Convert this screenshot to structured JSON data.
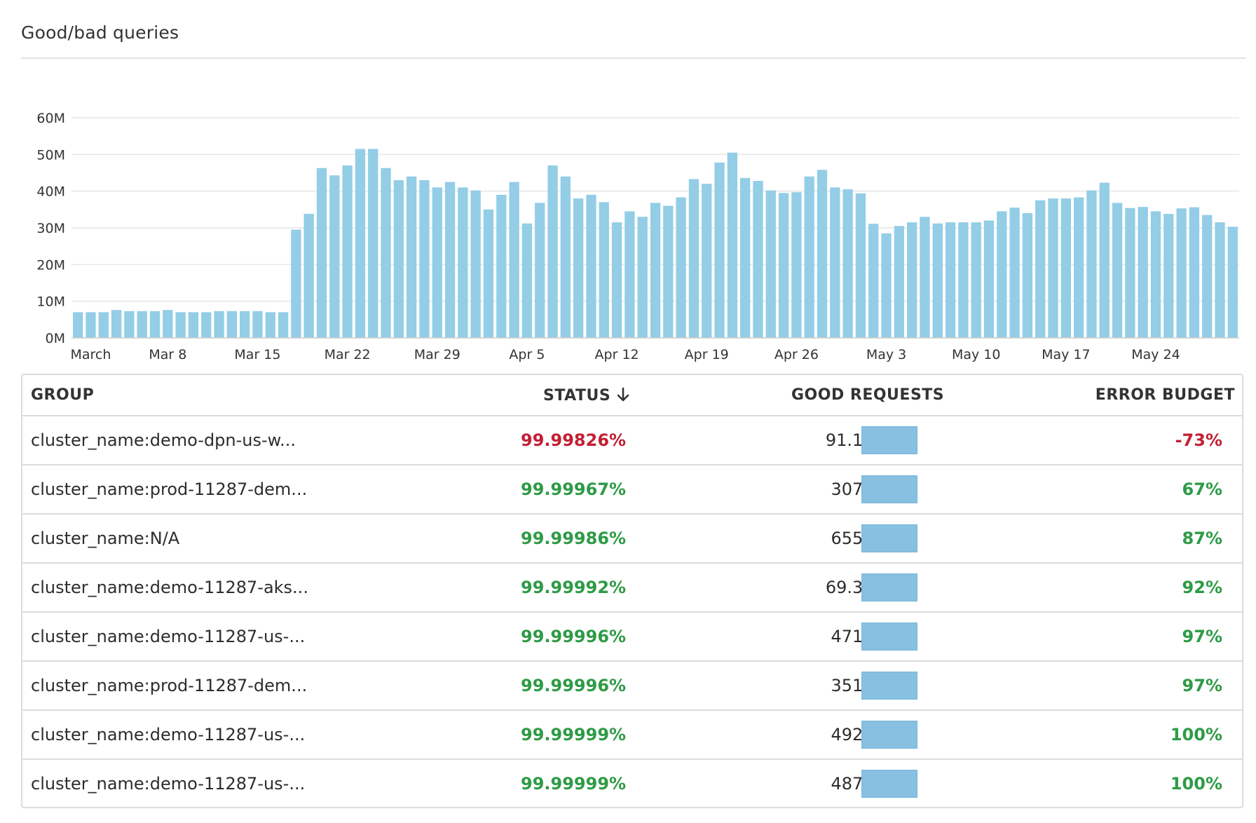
{
  "widget": {
    "title": "Good/bad queries"
  },
  "colors": {
    "bar": "#93cde6",
    "grid": "#e6e6e6",
    "good": "#2e9b46",
    "bad": "#c41f34",
    "row_bar": "#87c0e1"
  },
  "chart_data": {
    "type": "bar",
    "title": "",
    "ylim": [
      0,
      60000000
    ],
    "y_ticks": [
      "0M",
      "10M",
      "20M",
      "30M",
      "40M",
      "50M",
      "60M"
    ],
    "x_tick_labels": [
      "March",
      "Mar 8",
      "Mar 15",
      "Mar 22",
      "Mar 29",
      "Apr 5",
      "Apr 12",
      "Apr 19",
      "Apr 26",
      "May 3",
      "May 10",
      "May 17",
      "May 24"
    ],
    "grid": true,
    "categories": [
      "Mar 1",
      "Mar 2",
      "Mar 3",
      "Mar 4",
      "Mar 5",
      "Mar 6",
      "Mar 7",
      "Mar 8",
      "Mar 9",
      "Mar 10",
      "Mar 11",
      "Mar 12",
      "Mar 13",
      "Mar 14",
      "Mar 15",
      "Mar 16",
      "Mar 17",
      "Mar 18",
      "Mar 19",
      "Mar 20",
      "Mar 21",
      "Mar 22",
      "Mar 23",
      "Mar 24",
      "Mar 25",
      "Mar 26",
      "Mar 27",
      "Mar 28",
      "Mar 29",
      "Mar 30",
      "Mar 31",
      "Apr 1",
      "Apr 2",
      "Apr 3",
      "Apr 4",
      "Apr 5",
      "Apr 6",
      "Apr 7",
      "Apr 8",
      "Apr 9",
      "Apr 10",
      "Apr 11",
      "Apr 12",
      "Apr 13",
      "Apr 14",
      "Apr 15",
      "Apr 16",
      "Apr 17",
      "Apr 18",
      "Apr 19",
      "Apr 20",
      "Apr 21",
      "Apr 22",
      "Apr 23",
      "Apr 24",
      "Apr 25",
      "Apr 26",
      "Apr 27",
      "Apr 28",
      "Apr 29",
      "Apr 30",
      "May 1",
      "May 2",
      "May 3",
      "May 4",
      "May 5",
      "May 6",
      "May 7",
      "May 8",
      "May 9",
      "May 10",
      "May 11",
      "May 12",
      "May 13",
      "May 14",
      "May 15",
      "May 16",
      "May 17",
      "May 18",
      "May 19",
      "May 20",
      "May 21",
      "May 22",
      "May 23",
      "May 24",
      "May 25",
      "May 26",
      "May 27",
      "May 28"
    ],
    "values": [
      7.0,
      7.0,
      7.0,
      7.6,
      7.3,
      7.3,
      7.3,
      7.6,
      7.0,
      7.0,
      7.0,
      7.3,
      7.3,
      7.3,
      7.3,
      7.0,
      7.0,
      29.5,
      33.8,
      46.3,
      44.3,
      47.0,
      51.5,
      51.5,
      46.3,
      43.0,
      44.0,
      43.0,
      41.0,
      42.5,
      41.0,
      40.2,
      35.0,
      39.0,
      42.5,
      31.2,
      36.8,
      47.0,
      44.0,
      38.0,
      39.0,
      37.0,
      31.5,
      34.5,
      33.0,
      36.8,
      36.0,
      38.3,
      43.3,
      42.0,
      47.8,
      50.5,
      43.6,
      42.8,
      40.2,
      39.5,
      39.7,
      44.0,
      45.8,
      41.0,
      40.5,
      39.4,
      31.1,
      28.5,
      30.5,
      31.5,
      33.0,
      31.2,
      31.5,
      31.5,
      31.5,
      32.0,
      34.5,
      35.5,
      34.0,
      37.5,
      38.0,
      38.0,
      38.3,
      40.2,
      42.3,
      36.8,
      35.4,
      35.7,
      34.5,
      33.8,
      35.3,
      35.6,
      33.5,
      31.5,
      30.3
    ],
    "value_unit": "M"
  },
  "table": {
    "headers": {
      "group": "GROUP",
      "status": "STATUS",
      "good_requests": "GOOD REQUESTS",
      "error_budget": "ERROR BUDGET"
    },
    "sort_icon": "arrow-down-icon",
    "rows": [
      {
        "group": "cluster_name:demo-dpn-us-w...",
        "status": "99.99826%",
        "good_requests": "91.1M",
        "error_budget": "-73%",
        "level": "bad"
      },
      {
        "group": "cluster_name:prod-11287-dem...",
        "status": "99.99967%",
        "good_requests": "307M",
        "error_budget": "67%",
        "level": "good"
      },
      {
        "group": "cluster_name:N/A",
        "status": "99.99986%",
        "good_requests": "655M",
        "error_budget": "87%",
        "level": "good"
      },
      {
        "group": "cluster_name:demo-11287-aks...",
        "status": "99.99992%",
        "good_requests": "69.3M",
        "error_budget": "92%",
        "level": "good"
      },
      {
        "group": "cluster_name:demo-11287-us-...",
        "status": "99.99996%",
        "good_requests": "471M",
        "error_budget": "97%",
        "level": "good"
      },
      {
        "group": "cluster_name:prod-11287-dem...",
        "status": "99.99996%",
        "good_requests": "351M",
        "error_budget": "97%",
        "level": "good"
      },
      {
        "group": "cluster_name:demo-11287-us-...",
        "status": "99.99999%",
        "good_requests": "492M",
        "error_budget": "100%",
        "level": "good"
      },
      {
        "group": "cluster_name:demo-11287-us-...",
        "status": "99.99999%",
        "good_requests": "487M",
        "error_budget": "100%",
        "level": "good"
      }
    ]
  }
}
